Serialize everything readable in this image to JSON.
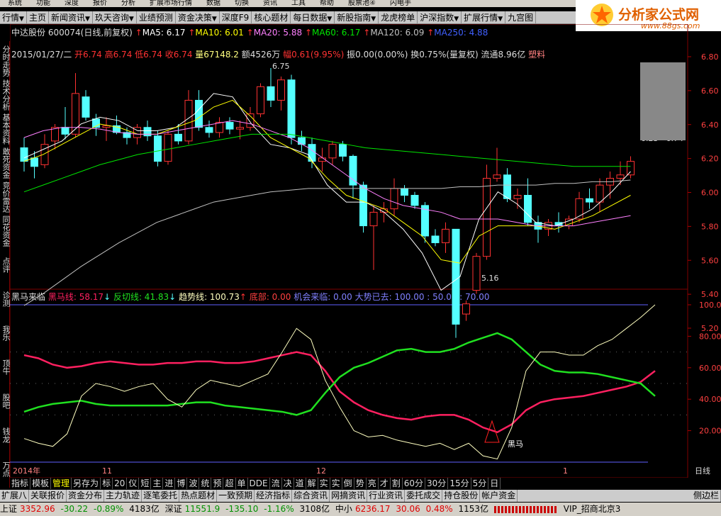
{
  "menubar": [
    "系统",
    "功能",
    "深度",
    "报价",
    "分析",
    "扩展市场行情",
    "数据",
    "切换",
    "资讯",
    "工具",
    "帮助",
    "股票池④",
    "闪电手"
  ],
  "menu2": [
    {
      "label": "行情",
      "arrow": true
    },
    {
      "label": "主页",
      "arrow": false
    },
    {
      "label": "新闻资讯",
      "arrow": true
    },
    {
      "label": "玖天咨询",
      "arrow": true
    },
    {
      "label": "业绩预测",
      "arrow": false
    },
    {
      "label": "资金决策",
      "arrow": true
    },
    {
      "label": "深度F9",
      "arrow": false
    },
    {
      "label": "核心题材",
      "arrow": false
    },
    {
      "label": "每日数据",
      "arrow": true
    },
    {
      "label": "新股指南",
      "arrow": true
    },
    {
      "label": "龙虎榜单",
      "arrow": false
    },
    {
      "label": "沪深指数",
      "arrow": true
    },
    {
      "label": "扩展行情",
      "arrow": true
    },
    {
      "label": "九宫图",
      "arrow": false
    }
  ],
  "logo": {
    "brand": "分析家公式网",
    "url": "www.88gs.com"
  },
  "leftbar": [
    "分时走势",
    "技术分析",
    "基本资料",
    "敢死资金",
    "竞价雷达",
    "同花资金",
    "点评",
    "诊测",
    "我乐",
    "顶牛",
    "股吧",
    "钱龙",
    "万点"
  ],
  "stock": {
    "name": "中达股份",
    "code": "600074",
    "mode": "(日线,前复权)",
    "ma5": "MA5: 6.17",
    "ma10": "MA10: 6.01",
    "ma20": "MA20: 5.88",
    "ma60": "MA60: 6.17",
    "ma120": "MA120: 6.09",
    "ma250": "MA250: 4.88"
  },
  "quote": {
    "date": "2015/01/27/二",
    "open": "开6.74",
    "high": "高6.74",
    "low": "低6.74",
    "close": "收6.74",
    "volume": "量67148.2",
    "amount": "额4526万",
    "change": "幅0.61(9.95%)",
    "amplitude": "振0.00(0.00%)",
    "turnover": "换0.75%(量复权)",
    "float": "流通8.96亿",
    "sector": "塑料"
  },
  "indicator": {
    "name": "黑马来临",
    "heima": "黑马线: 58.17",
    "fanqie": "反切线: 41.83",
    "qushi": "趋势线: 100.73",
    "dibu": "底部: 0.00",
    "jihui": "机会来临: 0.00",
    "dashi": "大势已去: 100.00 : 50.00 : 70.00"
  },
  "annotations": {
    "high": "6.75",
    "low": "5.16",
    "range": "6.23 - 6.74",
    "heima_label": "黑马"
  },
  "price_axis": [
    "6.80",
    "6.60",
    "6.40",
    "6.20",
    "6.00",
    "5.80",
    "5.60",
    "5.40",
    "5.20"
  ],
  "ind_axis": [
    "100.0",
    "80.00",
    "60.00",
    "40.00",
    "20.00"
  ],
  "date_axis": {
    "y2014": "2014年",
    "m11": "11",
    "m12": "12",
    "m1": "1",
    "period": "日线"
  },
  "tabs": [
    {
      "label": "指标",
      "sel": false
    },
    {
      "label": "模板",
      "sel": false
    },
    {
      "label": "管理",
      "sel": true
    },
    {
      "label": "另存为",
      "sel": false
    },
    {
      "label": "标",
      "sel": false
    },
    {
      "label": "20",
      "sel": false
    },
    {
      "label": "仪",
      "sel": false
    },
    {
      "label": "短",
      "sel": false
    },
    {
      "label": "主",
      "sel": false
    },
    {
      "label": "进",
      "sel": false
    },
    {
      "label": "博",
      "sel": false
    },
    {
      "label": "波",
      "sel": false
    },
    {
      "label": "统",
      "sel": false
    },
    {
      "label": "预",
      "sel": false
    },
    {
      "label": "超",
      "sel": false
    },
    {
      "label": "单",
      "sel": false
    },
    {
      "label": "DDE",
      "sel": false
    },
    {
      "label": "流",
      "sel": false
    },
    {
      "label": "决",
      "sel": false
    },
    {
      "label": "道",
      "sel": false
    },
    {
      "label": "解",
      "sel": false
    },
    {
      "label": "实",
      "sel": false
    },
    {
      "label": "实",
      "sel": false
    },
    {
      "label": "倒",
      "sel": false
    },
    {
      "label": "势",
      "sel": false
    },
    {
      "label": "亮",
      "sel": false
    },
    {
      "label": "才",
      "sel": false
    },
    {
      "label": "割",
      "sel": false
    },
    {
      "label": "60分",
      "sel": false
    },
    {
      "label": "30分",
      "sel": false
    },
    {
      "label": "15分",
      "sel": false
    },
    {
      "label": "5分",
      "sel": false
    },
    {
      "label": "日",
      "sel": false
    }
  ],
  "tabs2": [
    "扩展八",
    "关联报价",
    "资金分布",
    "主力轨迹",
    "逐笔委托",
    "热点题材",
    "一致预期",
    "经济指标",
    "综合资讯",
    "网摘资讯",
    "行业资讯",
    "委托成交",
    "持仓股份",
    "帐户资金"
  ],
  "tabs2_right": "侧边栏",
  "status": {
    "sh_label": "上证",
    "sh_val": "3352.96",
    "sh_chg": "-30.22",
    "sh_pct": "-0.89%",
    "sh_amt": "4183亿",
    "sz_label": "深证",
    "sz_val": "11551.9",
    "sz_chg": "-135.10",
    "sz_pct": "-1.16%",
    "sz_amt": "3108亿",
    "zx_label": "中小",
    "zx_val": "6236.17",
    "zx_chg": "30.06",
    "zx_pct": "0.48%",
    "zx_amt": "1153亿",
    "broker": "VIP_招商北京3"
  },
  "colors": {
    "up": "#ff3232",
    "down": "#54ffff",
    "ma5": "#ffffff",
    "ma10": "#ffff00",
    "ma20": "#ff80ff",
    "ma60": "#00e600",
    "ma120": "#c0c0c0",
    "heima": "#ff2060",
    "fanqie": "#20e020",
    "qushi": "#ffffc0"
  }
}
